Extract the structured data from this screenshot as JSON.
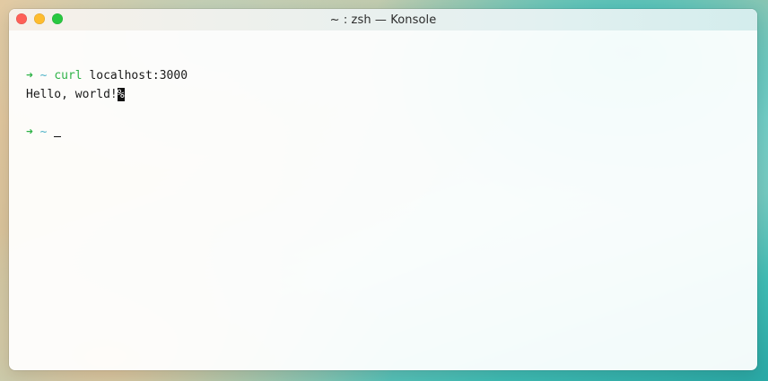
{
  "window": {
    "title": "~ : zsh — Konsole",
    "buttons": {
      "close": "close",
      "minimize": "minimize",
      "maximize": "maximize"
    }
  },
  "terminal": {
    "lines": [
      {
        "prompt_arrow": "➜",
        "prompt_dir": "~",
        "command": "curl",
        "args": "localhost:3000"
      },
      {
        "output": "Hello, world!",
        "eol_marker": "%"
      },
      {
        "prompt_arrow": "➜",
        "prompt_dir": "~"
      }
    ]
  },
  "colors": {
    "prompt_arrow": "#2fb348",
    "prompt_dir": "#4fb3c8",
    "command": "#2fb348",
    "close_button": "#fe5f57",
    "minimize_button": "#febc2e",
    "maximize_button": "#28c840"
  }
}
